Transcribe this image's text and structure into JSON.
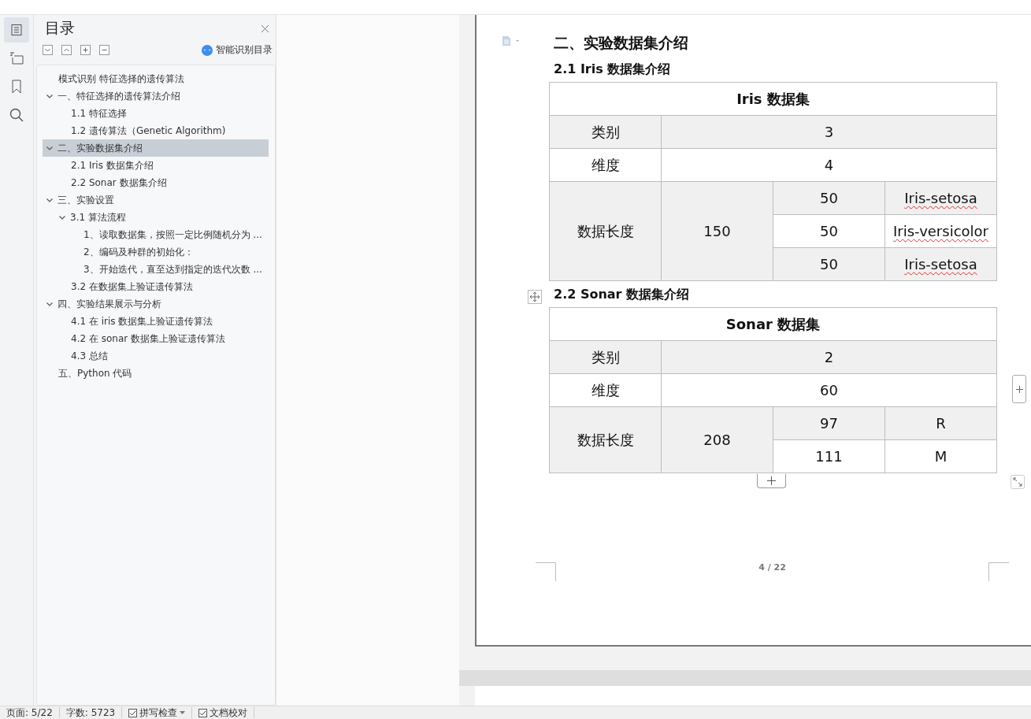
{
  "side_tabs": [
    {
      "kind": "outline",
      "selected": true
    },
    {
      "kind": "navigation",
      "selected": false
    },
    {
      "kind": "bookmark",
      "selected": false
    },
    {
      "kind": "search",
      "selected": false
    }
  ],
  "outline_panel": {
    "title": "目录",
    "smart_button": "智能识别目录",
    "items": [
      {
        "label": "模式识别  特征选择的遗传算法",
        "selected": false
      },
      {
        "label": "一、特征选择的遗传算法介绍",
        "selected": false,
        "expanded": true,
        "children": [
          {
            "label": "1.1  特征选择",
            "selected": false
          },
          {
            "label": "1.2  遗传算法（Genetic Algorithm)",
            "selected": false
          }
        ]
      },
      {
        "label": "二、实验数据集介绍",
        "selected": true,
        "expanded": true,
        "children": [
          {
            "label": "2.1 Iris 数据集介绍",
            "selected": false
          },
          {
            "label": "2.2 Sonar 数据集介绍",
            "selected": false
          }
        ]
      },
      {
        "label": "三、实验设置",
        "selected": false,
        "expanded": true,
        "children": [
          {
            "label": "3.1  算法流程",
            "selected": false,
            "expanded": true,
            "children": [
              {
                "label": "1、读取数据集，按照一定比例随机分为 ...",
                "selected": false
              },
              {
                "label": "2、编码及种群的初始化：",
                "selected": false
              },
              {
                "label": "3、开始迭代，直至达到指定的迭代次数 ...",
                "selected": false
              }
            ]
          },
          {
            "label": "3.2  在数据集上验证遗传算法",
            "selected": false
          }
        ]
      },
      {
        "label": "四、实验结果展示与分析",
        "selected": false,
        "expanded": true,
        "children": [
          {
            "label": "4.1  在 iris 数据集上验证遗传算法",
            "selected": false
          },
          {
            "label": "4.2  在 sonar 数据集上验证遗传算法",
            "selected": false
          },
          {
            "label": "4.3  总结",
            "selected": false
          }
        ]
      },
      {
        "label": "五、Python 代码",
        "selected": false
      }
    ]
  },
  "document": {
    "heading": "二、实验数据集介绍",
    "sections": [
      {
        "title": "2.1 Iris 数据集介绍",
        "table": {
          "caption": "Iris  数据集",
          "rows": [
            {
              "label": "类别",
              "value": "3"
            },
            {
              "label": "维度",
              "value": "4"
            }
          ],
          "length": {
            "label": "数据长度",
            "total": "150",
            "classes": [
              {
                "count": "50",
                "name": "Iris-setosa",
                "spell_error": true
              },
              {
                "count": "50",
                "name": "Iris-versicolor",
                "spell_error": true
              },
              {
                "count": "50",
                "name": "Iris-setosa",
                "spell_error": true
              }
            ]
          }
        }
      },
      {
        "title": "2.2 Sonar 数据集介绍",
        "table": {
          "caption": "Sonar  数据集",
          "rows": [
            {
              "label": "类别",
              "value": "2"
            },
            {
              "label": "维度",
              "value": "60"
            }
          ],
          "length": {
            "label": "数据长度",
            "total": "208",
            "classes": [
              {
                "count": "97",
                "name": "R",
                "spell_error": false
              },
              {
                "count": "111",
                "name": "M",
                "spell_error": false
              }
            ]
          }
        }
      }
    ],
    "page_number": "4 / 22"
  },
  "status_bar": {
    "page": "页面: 5/22",
    "words": "字数: 5723",
    "spell_check": {
      "label": "拼写检查",
      "checked": true
    },
    "proofread": {
      "label": "文档校对",
      "checked": true
    }
  }
}
